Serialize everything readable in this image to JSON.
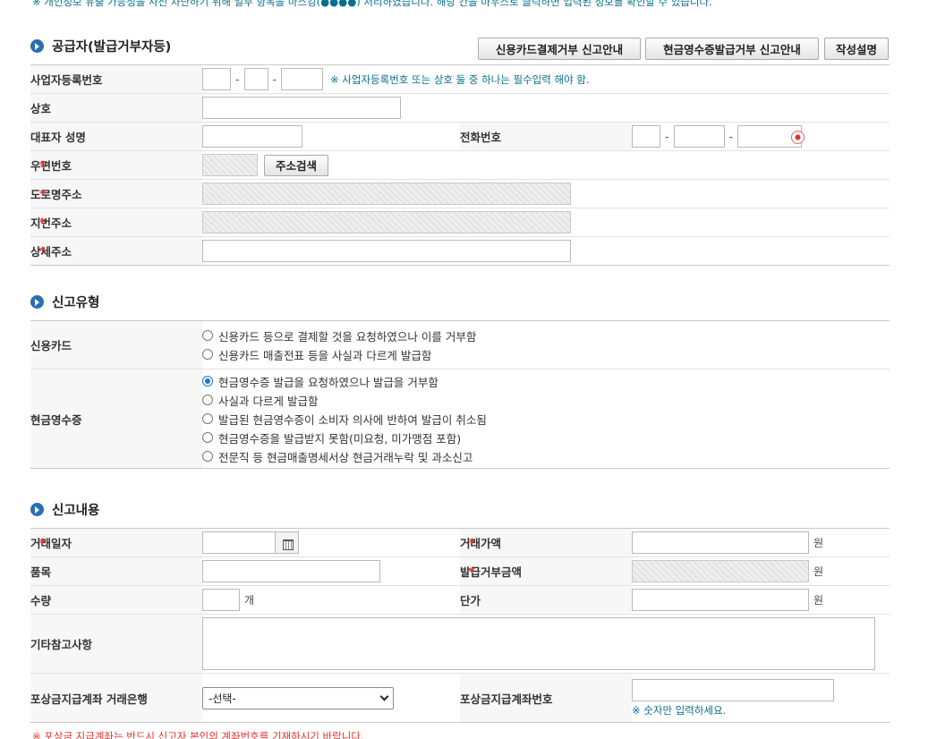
{
  "notice_top": "※ 개인정보 유출 가능성을 사전 차단하기 위해 일부 항목을 마스킹(●●●●) 처리하였습니다. 해당 칸을 마우스로 클릭하면 입력된 정보를 확인할 수 있습니다.",
  "supplier": {
    "title": "공급자(발급거부자등)",
    "buttons": {
      "card_guide": "신용카드결제거부 신고안내",
      "cash_guide": "현금영수증발급거부 신고안내",
      "help": "작성설명"
    },
    "biz_no_label": "사업자등록번호",
    "biz_no_hint": "※ 사업자등록번호 또는 상호 둘 중 하나는 필수입력 해야 함.",
    "name_label": "상호",
    "ceo_label": "대표자 성명",
    "phone_label": "전화번호",
    "postal_label": "우편번호",
    "postal_btn": "주소검색",
    "road_label": "도로명주소",
    "jibun_label": "지번주소",
    "detail_label": "상세주소"
  },
  "report_type": {
    "title": "신고유형",
    "card_label": "신용카드",
    "card_options": [
      "신용카드 등으로 결제할 것을 요청하였으나 이를 거부함",
      "신용카드 매출전표 등을 사실과 다르게 발급함"
    ],
    "cash_label": "현금영수증",
    "cash_options": [
      "현금영수증 발급을 요청하였으나 발급을 거부함",
      "사실과 다르게 발급함",
      "발급된 현금영수증이 소비자 의사에 반하여 발급이 취소됨",
      "현금영수증을 발급받지 못함(미요청, 미가맹점 포함)",
      "전문직 등 현금매출명세서상 현금거래누락 및 과소신고"
    ],
    "cash_selected": 0
  },
  "report_detail": {
    "title": "신고내용",
    "date_label": "거래일자",
    "amount_label": "거래가액",
    "item_label": "품목",
    "refused_label": "발급거부금액",
    "qty_label": "수량",
    "qty_unit": "개",
    "price_label": "단가",
    "won": "원",
    "etc_label": "기타참고사항",
    "bank_label": "포상금지급계좌 거래은행",
    "bank_value": "-선택-",
    "account_label": "포상금지급계좌번호",
    "account_hint": "※ 숫자만 입력하세요."
  },
  "footnote": "※ 포상금 지급계좌는 반드시 신고자 본인의 계좌번호를 기재하시기 바랍니다."
}
